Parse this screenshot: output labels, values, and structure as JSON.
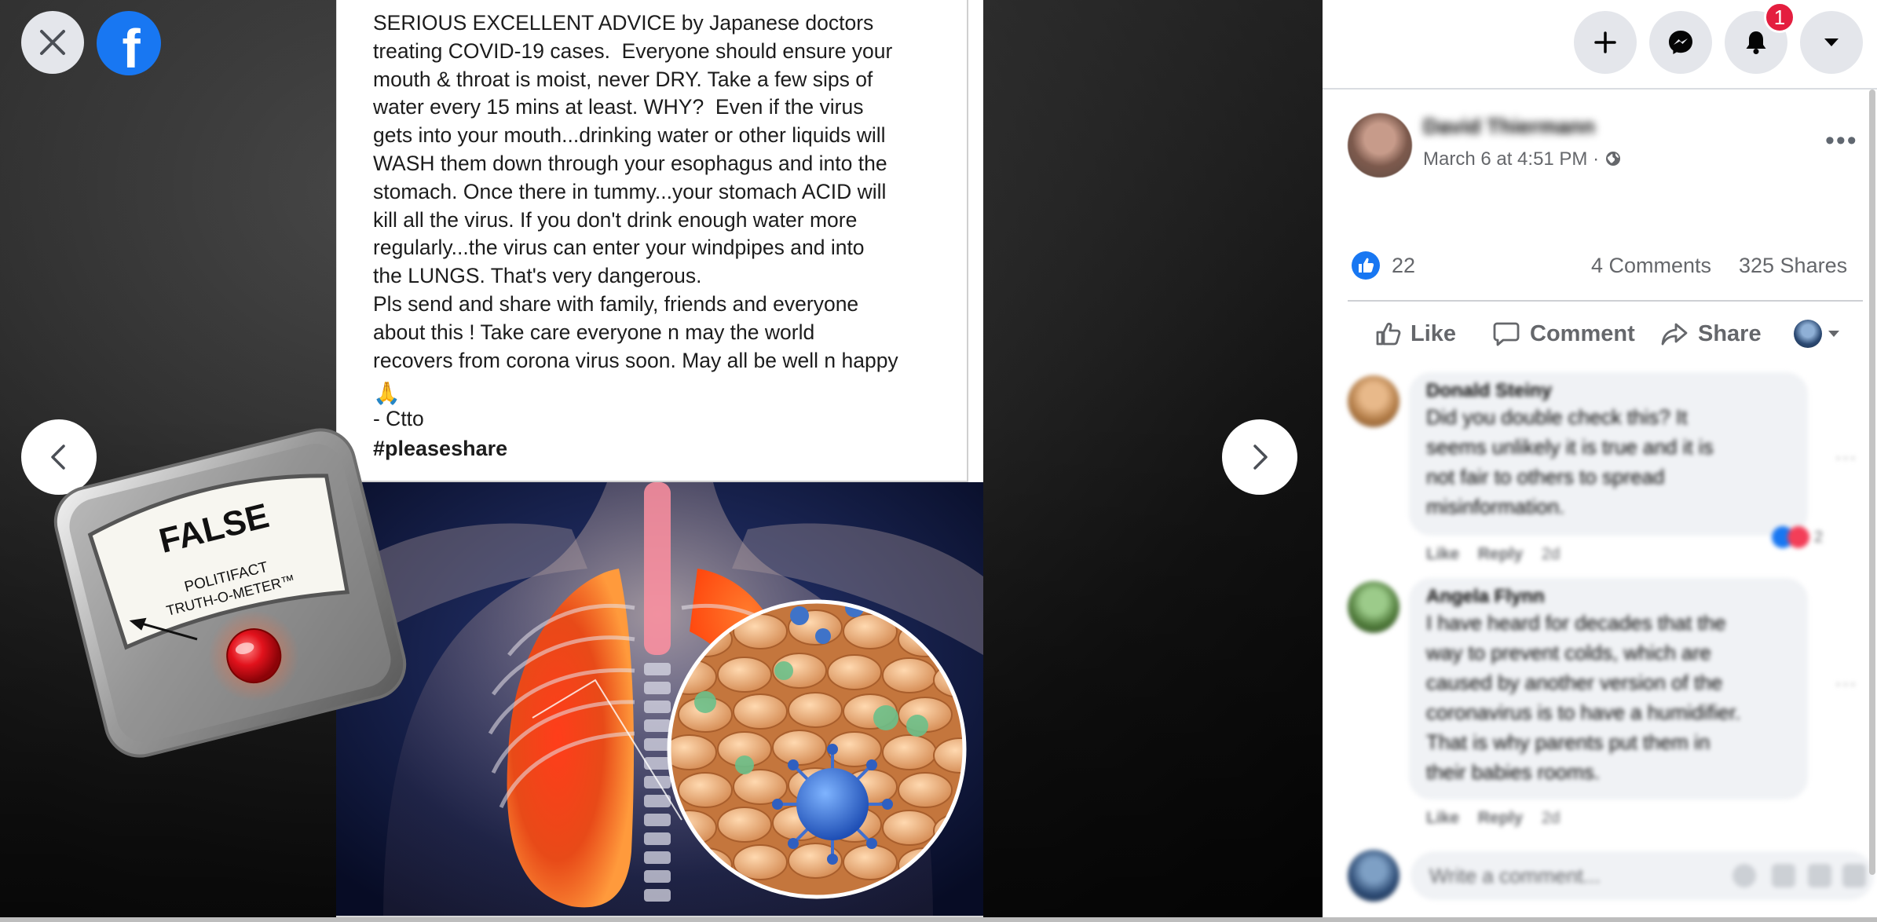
{
  "viewer": {
    "close_icon": "close-icon",
    "logo_icon": "facebook-logo",
    "prev_icon": "chevron-left-icon",
    "next_icon": "chevron-right-icon",
    "photo": {
      "body": "SERIOUS EXCELLENT ADVICE by Japanese doctors\ntreating COVID-19 cases.  Everyone should ensure your\nmouth & throat is moist, never DRY. Take a few sips of\nwater every 15 mins at least. WHY?  Even if the virus\ngets into your mouth...drinking water or other liquids will\nWASH them down through your esophagus and into the\nstomach. Once there in tummy...your stomach ACID will\nkill all the virus. If you don't drink enough water more\nregularly...the virus can enter your windpipes and into\nthe LUNGS. That's very dangerous.\nPls send and share with family, friends and everyone\nabout this ! Take care everyone n may the world\nrecovers from corona virus soon. May all be well n happy",
      "emoji": "🙏",
      "signoff": "- Ctto",
      "hashtag": "#pleaseshare"
    },
    "meter": {
      "rating": "FALSE",
      "brand_line1": "POLITIFACT",
      "brand_line2": "TRUTH-O-METER™"
    }
  },
  "topbar": {
    "create_icon": "plus-icon",
    "messenger_icon": "messenger-icon",
    "notifications_icon": "bell-icon",
    "notifications_badge": "1",
    "account_icon": "caret-down-icon"
  },
  "post": {
    "author": "David Thiermann",
    "date": "March 6 at 4:51 PM · ",
    "privacy_icon": "globe-icon",
    "like_count": "22",
    "comments": "4 Comments",
    "shares": "325 Shares",
    "actions": {
      "like": "Like",
      "comment": "Comment",
      "share": "Share"
    }
  },
  "comments": [
    {
      "name": "Donald Steiny",
      "text": "Did you double check this? It\nseems unlikely it is true and it is\nnot fair to others to spread\nmisinformation.",
      "like": "Like",
      "reply": "Reply",
      "age": "2d",
      "reaction_count": "2"
    },
    {
      "name": "Angela Flynn",
      "text": "I have heard for decades that the\nway to prevent colds, which are\ncaused by another version of the\ncoronavirus is to have a humidifier.\nThat is why parents put them in\ntheir babies rooms.",
      "like": "Like",
      "reply": "Reply",
      "age": "2d"
    }
  ],
  "composer": {
    "placeholder": "Write a comment..."
  },
  "colors": {
    "facebook_blue": "#1877f2",
    "badge_red": "#e41e3f",
    "meter_red": "#d8121b"
  }
}
